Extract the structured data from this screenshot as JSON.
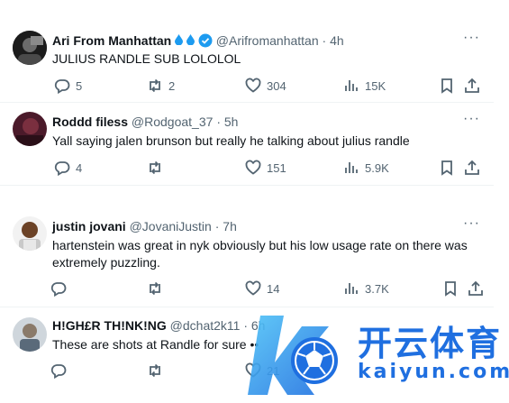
{
  "tweets": [
    {
      "name": "Ari From Manhattan",
      "handle": "@Arifromanhattan",
      "dot": "·",
      "time": "4h",
      "text": "JULIUS RANDLE SUB LOLOLOL",
      "replies": "5",
      "retweets": "2",
      "likes": "304",
      "views": "15K",
      "badges": [
        "water-drop-icon",
        "water-drop-icon",
        "verified-badge-icon"
      ]
    },
    {
      "name": "Roddd filess",
      "handle": "@Rodgoat_37",
      "dot": "·",
      "time": "5h",
      "text": "Yall saying jalen brunson but really he talking about julius randle",
      "replies": "4",
      "retweets": "",
      "likes": "151",
      "views": "5.9K"
    },
    {
      "name": "justin jovani",
      "handle": "@JovaniJustin",
      "dot": "·",
      "time": "7h",
      "text_line1": "hartenstein was great in nyk obviously but his low usage rate on there was",
      "text_line2": "extremely puzzling.",
      "replies": "",
      "retweets": "",
      "likes": "14",
      "views": "3.7K"
    },
    {
      "name": "H!GH£R TH!NK!NG",
      "handle": "@dchat2k11",
      "dot": "·",
      "time": "6h",
      "text": "These are shots at Randle for sure",
      "text_tail": "••",
      "replies": "",
      "retweets": "",
      "likes": "21"
    }
  ],
  "watermark": {
    "brand_cn": "开云体育",
    "brand_en": "kaiyun.com"
  },
  "colors": {
    "text": "#0f1419",
    "secondary": "#536471",
    "verified": "#1d9bf0",
    "drop": "#1d9bf0",
    "watermark_blue": "#1f6fe0"
  }
}
